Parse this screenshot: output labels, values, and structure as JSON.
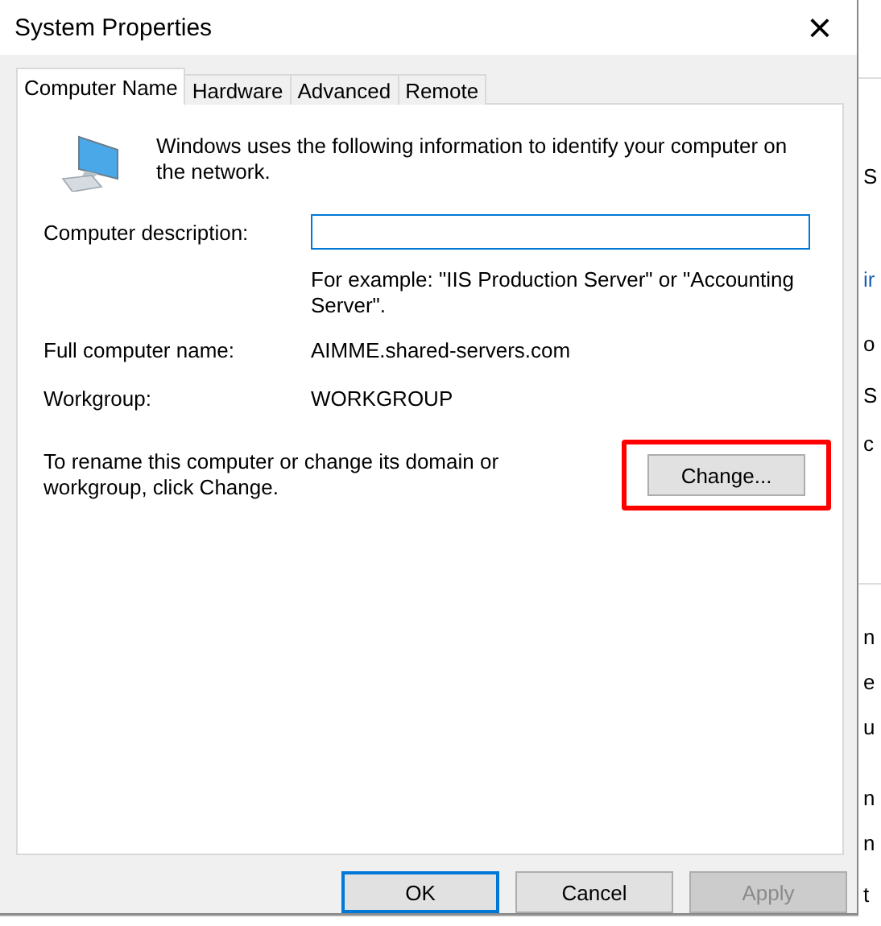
{
  "window": {
    "title": "System Properties",
    "close": "×"
  },
  "tabs": [
    {
      "label": "Computer Name",
      "selected": true
    },
    {
      "label": "Hardware",
      "selected": false
    },
    {
      "label": "Advanced",
      "selected": false
    },
    {
      "label": "Remote",
      "selected": false
    }
  ],
  "intro": "Windows uses the following information to identify your computer on the network.",
  "description_field": {
    "label": "Computer description:",
    "focused": true
  },
  "example": "For example: \"IIS Production Server\" or \"Accounting Server\".",
  "fields": [
    {
      "label": "Full computer name:",
      "value": "AIMME.shared-servers.com"
    },
    {
      "label": "Workgroup:",
      "value": "WORKGROUP"
    }
  ],
  "rename": {
    "text": "To rename this computer or change its domain or workgroup, click Change.",
    "button": "Change...",
    "highlighted": true
  },
  "buttons": [
    {
      "label": "OK",
      "default": true,
      "disabled": false
    },
    {
      "label": "Cancel",
      "default": false,
      "disabled": false
    },
    {
      "label": "Apply",
      "default": false,
      "disabled": true
    }
  ],
  "background_window": {
    "fragments": [
      "S",
      "ir",
      "o",
      "S",
      "c",
      "n",
      "e",
      "u",
      "n",
      "n",
      "t"
    ]
  }
}
